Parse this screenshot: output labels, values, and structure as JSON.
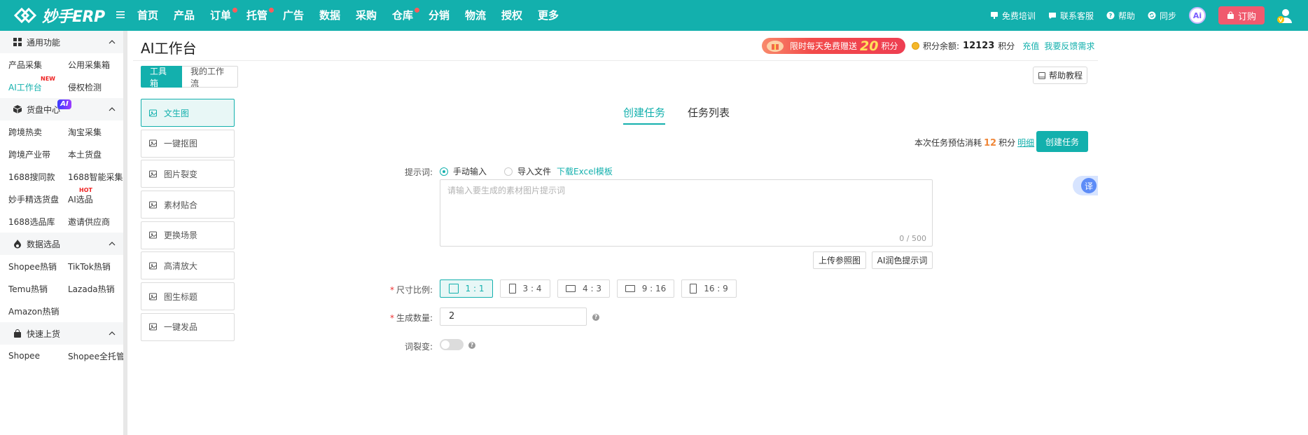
{
  "topbar": {
    "logo_text": "妙手ERP",
    "nav": [
      {
        "label": "首页",
        "dot": false
      },
      {
        "label": "产品",
        "dot": false
      },
      {
        "label": "订单",
        "dot": true
      },
      {
        "label": "托管",
        "dot": true
      },
      {
        "label": "广告",
        "dot": false
      },
      {
        "label": "数据",
        "dot": false
      },
      {
        "label": "采购",
        "dot": false
      },
      {
        "label": "仓库",
        "dot": true
      },
      {
        "label": "分销",
        "dot": false
      },
      {
        "label": "物流",
        "dot": false
      },
      {
        "label": "授权",
        "dot": false
      },
      {
        "label": "更多",
        "dot": false
      }
    ],
    "free_training": "免费培训",
    "contact_support": "联系客服",
    "help": "帮助",
    "sync": "同步",
    "ai_avatar": "Ai",
    "order_label": "订购",
    "accent_color": "#13b0ad"
  },
  "sidebar": {
    "groups": [
      {
        "title": "通用功能",
        "icon": "grid-icon",
        "rows": [
          [
            "产品采集",
            "公用采集箱"
          ],
          [
            "AI工作台",
            "侵权检测"
          ]
        ]
      },
      {
        "title": "货盘中心",
        "icon": "cube-icon",
        "badge": "AI",
        "rows": [
          [
            "跨境热卖",
            "淘宝采集"
          ],
          [
            "跨境产业带",
            "本土货盘"
          ],
          [
            "1688搜同款",
            "1688智能采集"
          ],
          [
            "妙手精选货盘",
            "AI选品"
          ],
          [
            "1688选品库",
            "邀请供应商"
          ]
        ]
      },
      {
        "title": "数据选品",
        "icon": "fire-icon",
        "rows": [
          [
            "Shopee热销",
            "TikTok热销"
          ],
          [
            "Temu热销",
            "Lazada热销"
          ],
          [
            "Amazon热销",
            ""
          ]
        ]
      },
      {
        "title": "快速上货",
        "icon": "bag-icon",
        "rows": [
          [
            "Shopee",
            "Shopee全托管"
          ]
        ]
      }
    ],
    "new_tag": "NEW",
    "hot_tag": "HOT"
  },
  "main": {
    "title": "AI工作台",
    "promo": {
      "prefix": "限时每天免费赠送",
      "amount": "20",
      "suffix": "积分"
    },
    "balance": {
      "label": "积分余额:",
      "value": "12123",
      "unit": "积分",
      "recharge": "充值",
      "feedback": "我要反馈需求"
    },
    "tabs": [
      {
        "label": "工具箱"
      },
      {
        "label": "我的工作流"
      }
    ],
    "help_tutorial": "帮助教程",
    "tools": [
      {
        "label": "文生图",
        "icon": "text-to-image-icon"
      },
      {
        "label": "一键抠图",
        "icon": "cutout-icon"
      },
      {
        "label": "图片裂变",
        "icon": "image-variant-icon"
      },
      {
        "label": "素材贴合",
        "icon": "material-fit-icon"
      },
      {
        "label": "更换场景",
        "icon": "scene-swap-icon"
      },
      {
        "label": "高清放大",
        "icon": "upscale-icon"
      },
      {
        "label": "图生标题",
        "icon": "image-title-icon"
      },
      {
        "label": "一键发品",
        "icon": "publish-icon"
      }
    ],
    "content_tabs": [
      {
        "label": "创建任务"
      },
      {
        "label": "任务列表"
      }
    ],
    "cost": {
      "prefix": "本次任务预估消耗",
      "amount": "12",
      "unit": "积分",
      "detail": "明细"
    },
    "create_task": "创建任务",
    "prompt": {
      "label": "提示词:",
      "option_manual": "手动输入",
      "option_import": "导入文件",
      "download_template": "下载Excel模板",
      "placeholder": "请输入要生成的素材图片提示词",
      "count": "0 / 500",
      "upload_ref": "上传参照图",
      "ai_polish": "AI润色提示词"
    },
    "ratio": {
      "label": "尺寸比例:",
      "options": [
        "1 : 1",
        "3 : 4",
        "4 : 3",
        "9 : 16",
        "16 : 9"
      ],
      "selected": "1 : 1"
    },
    "quantity": {
      "label": "生成数量:",
      "value": "2"
    },
    "variation": {
      "label": "词裂变:",
      "enabled": false
    },
    "translate": "译"
  }
}
